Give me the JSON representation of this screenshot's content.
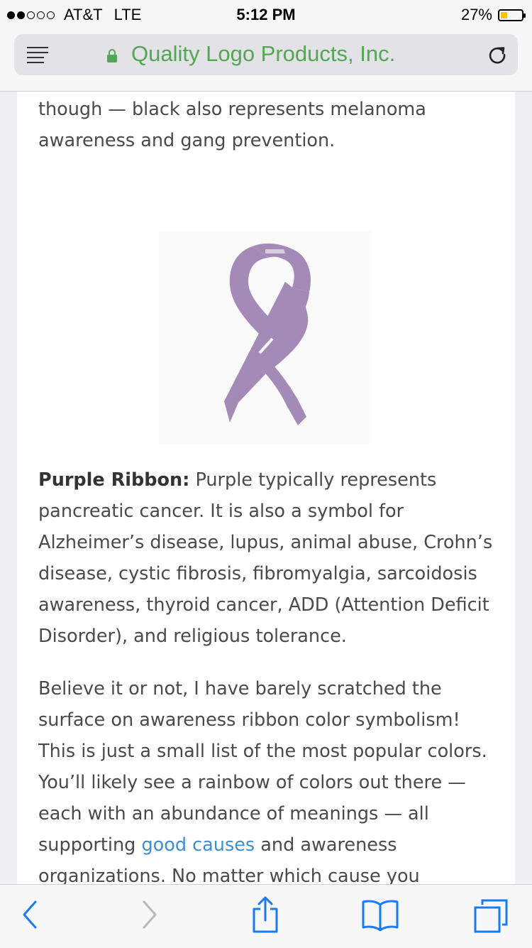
{
  "status_bar": {
    "carrier": "AT&T",
    "network": "LTE",
    "time": "5:12 PM",
    "battery_percent": "27%",
    "battery_level": 0.27,
    "signal_bars": 2
  },
  "address_bar": {
    "site_title": "Quality Logo Products, Inc.",
    "secure": true,
    "icons": [
      "reader-menu-icon",
      "lock-icon",
      "reload-icon"
    ]
  },
  "article": {
    "para_intro": "though — black also represents melanoma awareness and gang prevention.",
    "ribbon_color": "#a48ab6",
    "purple_heading": "Purple Ribbon:",
    "purple_text": " Purple typically represents pancreatic cancer. It is also a symbol for Alzheimer’s disease, lupus, animal abuse, Crohn’s disease, cystic fibrosis, fibromyalgia, sarcoidosis awareness, thyroid cancer, ADD (Attention Deficit Disorder), and religious tolerance.",
    "closing_before_link": "Believe it or not, I have barely scratched the surface on awareness ribbon color symbolism! This is just a small list of the most popular colors. You’ll likely see a rainbow of colors out there — each with an abundance of meanings — all supporting ",
    "closing_link": "good causes",
    "closing_after_link": " and awareness organizations. No matter which cause you support, be sure to do it with"
  },
  "toolbar": {
    "buttons": [
      "back-icon",
      "forward-icon",
      "share-icon",
      "bookmarks-icon",
      "tabs-icon"
    ],
    "accent_color": "#1a7cf2"
  }
}
